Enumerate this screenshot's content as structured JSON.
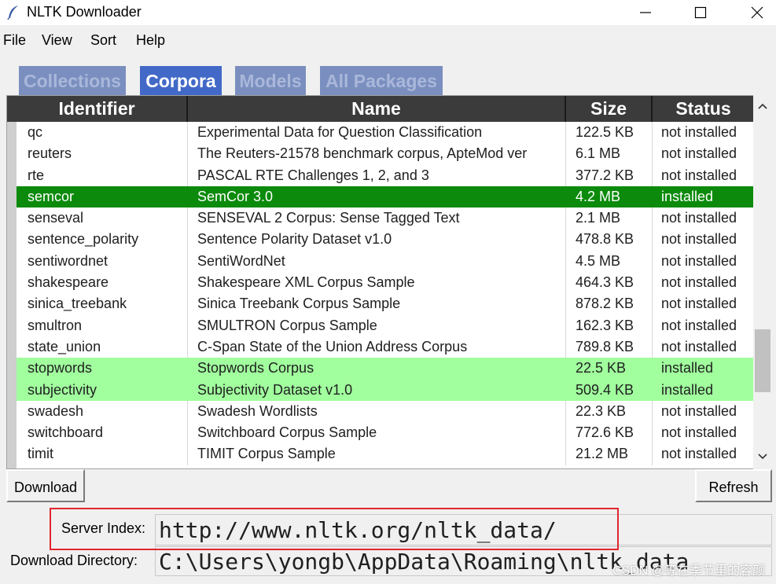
{
  "window": {
    "title": "NLTK Downloader"
  },
  "menu": [
    "File",
    "View",
    "Sort",
    "Help"
  ],
  "tabs": [
    {
      "label": "Collections",
      "active": false
    },
    {
      "label": "Corpora",
      "active": true
    },
    {
      "label": "Models",
      "active": false
    },
    {
      "label": "All Packages",
      "active": false
    }
  ],
  "table": {
    "columns": [
      "Identifier",
      "Name",
      "Size",
      "Status"
    ],
    "rows": [
      {
        "id": "qc",
        "name": "Experimental Data for Question Classification",
        "size": "122.5 KB",
        "status": "not installed",
        "state": "normal"
      },
      {
        "id": "reuters",
        "name": "The Reuters-21578 benchmark corpus, ApteMod ver",
        "size": "6.1 MB",
        "status": "not installed",
        "state": "normal"
      },
      {
        "id": "rte",
        "name": "PASCAL RTE Challenges 1, 2, and 3",
        "size": "377.2 KB",
        "status": "not installed",
        "state": "normal"
      },
      {
        "id": "semcor",
        "name": "SemCor 3.0",
        "size": "4.2 MB",
        "status": "installed",
        "state": "installed-selected"
      },
      {
        "id": "senseval",
        "name": "SENSEVAL 2 Corpus: Sense Tagged Text",
        "size": "2.1 MB",
        "status": "not installed",
        "state": "normal"
      },
      {
        "id": "sentence_polarity",
        "name": "Sentence Polarity Dataset v1.0",
        "size": "478.8 KB",
        "status": "not installed",
        "state": "normal"
      },
      {
        "id": "sentiwordnet",
        "name": "SentiWordNet",
        "size": "4.5 MB",
        "status": "not installed",
        "state": "normal"
      },
      {
        "id": "shakespeare",
        "name": "Shakespeare XML Corpus Sample",
        "size": "464.3 KB",
        "status": "not installed",
        "state": "normal"
      },
      {
        "id": "sinica_treebank",
        "name": "Sinica Treebank Corpus Sample",
        "size": "878.2 KB",
        "status": "not installed",
        "state": "normal"
      },
      {
        "id": "smultron",
        "name": "SMULTRON Corpus Sample",
        "size": "162.3 KB",
        "status": "not installed",
        "state": "normal"
      },
      {
        "id": "state_union",
        "name": "C-Span State of the Union Address Corpus",
        "size": "789.8 KB",
        "status": "not installed",
        "state": "normal"
      },
      {
        "id": "stopwords",
        "name": "Stopwords Corpus",
        "size": "22.5 KB",
        "status": "installed",
        "state": "installed"
      },
      {
        "id": "subjectivity",
        "name": "Subjectivity Dataset v1.0",
        "size": "509.4 KB",
        "status": "installed",
        "state": "installed"
      },
      {
        "id": "swadesh",
        "name": "Swadesh Wordlists",
        "size": "22.3 KB",
        "status": "not installed",
        "state": "normal"
      },
      {
        "id": "switchboard",
        "name": "Switchboard Corpus Sample",
        "size": "772.6 KB",
        "status": "not installed",
        "state": "normal"
      },
      {
        "id": "timit",
        "name": "TIMIT Corpus Sample",
        "size": "21.2 MB",
        "status": "not installed",
        "state": "normal"
      }
    ]
  },
  "buttons": {
    "download": "Download",
    "refresh": "Refresh"
  },
  "server_index": {
    "label": "Server Index:",
    "value": "http://www.nltk.org/nltk_data/"
  },
  "download_directory": {
    "label": "Download Directory:",
    "value": "C:\\Users\\yongb\\AppData\\Roaming\\nltk_data"
  },
  "watermark": "CSDN @等在季节里的容颜",
  "colors": {
    "tab_active": "#4269c7",
    "tab_inactive": "#7a8fbf",
    "header_bg": "#3b3b3b",
    "installed_selected": "#0b8a0b",
    "installed": "#a1ff9e",
    "highlight_box": "#e0262f"
  },
  "icons": {
    "app": "feather-icon",
    "minimize": "minimize-icon",
    "maximize": "maximize-icon",
    "close": "close-icon",
    "scroll_up": "chevron-up-icon",
    "scroll_down": "chevron-down-icon"
  }
}
